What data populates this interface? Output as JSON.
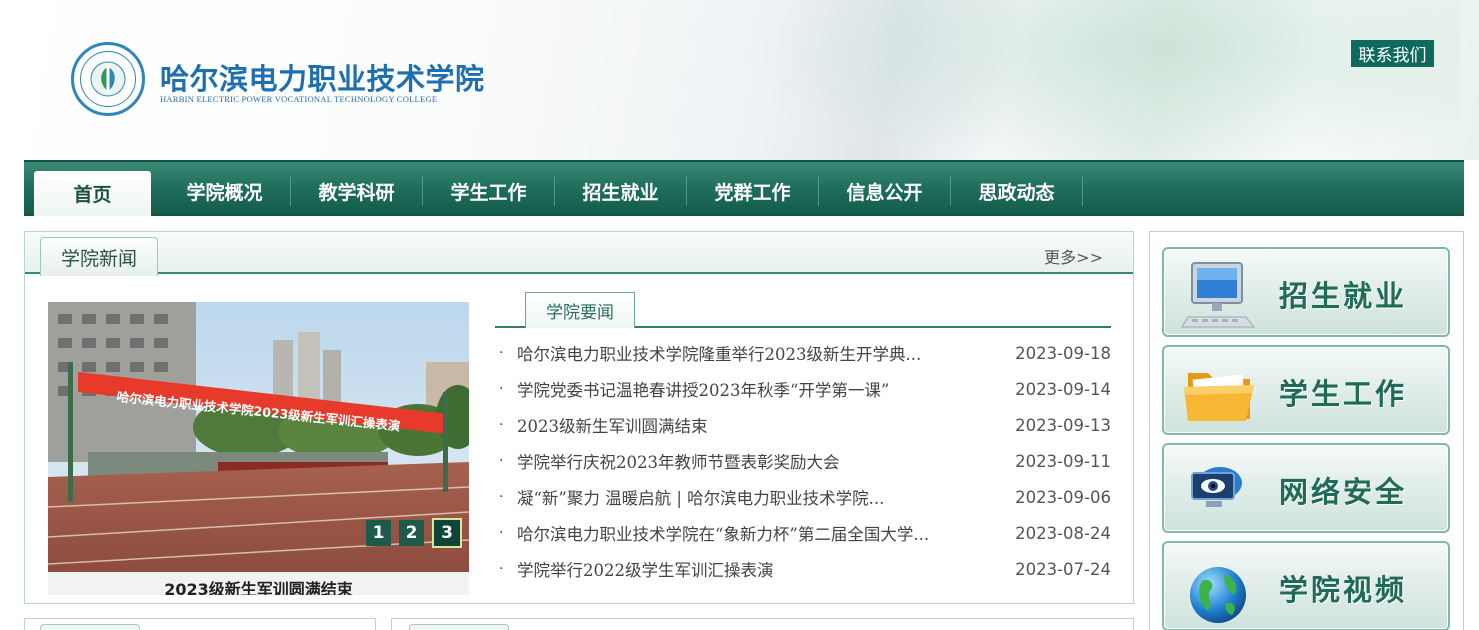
{
  "header": {
    "school_name": "哈尔滨电力职业技术学院",
    "school_name_en": "HARBIN ELECTRIC POWER VOCATIONAL TECHNOLOGY COLLEGE",
    "contact_label": "联系我们"
  },
  "nav": {
    "items": [
      "首页",
      "学院概况",
      "教学科研",
      "学生工作",
      "招生就业",
      "党群工作",
      "信息公开",
      "思政动态"
    ]
  },
  "news": {
    "tab_label": "学院新闻",
    "more_label": "更多>>",
    "slideshow": {
      "banner_text": "哈尔滨电力职业技术学院2023级新生军训汇操表演",
      "caption": "2023级新生军训圆满结束",
      "pages": [
        "1",
        "2",
        "3"
      ],
      "active_page": "3"
    },
    "sub_tab_label": "学院要闻",
    "bullet": "·",
    "items": [
      {
        "title": "哈尔滨电力职业技术学院隆重举行2023级新生开学典...",
        "date": "2023-09-18"
      },
      {
        "title": "学院党委书记温艳春讲授2023年秋季“开学第一课”",
        "date": "2023-09-14"
      },
      {
        "title": "2023级新生军训圆满结束",
        "date": "2023-09-13"
      },
      {
        "title": "学院举行庆祝2023年教师节暨表彰奖励大会",
        "date": "2023-09-11"
      },
      {
        "title": "凝“新”聚力 温暖启航 | 哈尔滨电力职业技术学院...",
        "date": "2023-09-06"
      },
      {
        "title": "哈尔滨电力职业技术学院在“象新力杯”第二届全国大学...",
        "date": "2023-08-24"
      },
      {
        "title": "学院举行2022级学生军训汇操表演",
        "date": "2023-07-24"
      }
    ]
  },
  "sidebar": {
    "buttons": [
      {
        "label": "招生就业",
        "icon": "computer-monitor-icon"
      },
      {
        "label": "学生工作",
        "icon": "folder-icon"
      },
      {
        "label": "网络安全",
        "icon": "network-security-icon"
      },
      {
        "label": "学院视频",
        "icon": "globe-icon"
      }
    ]
  }
}
